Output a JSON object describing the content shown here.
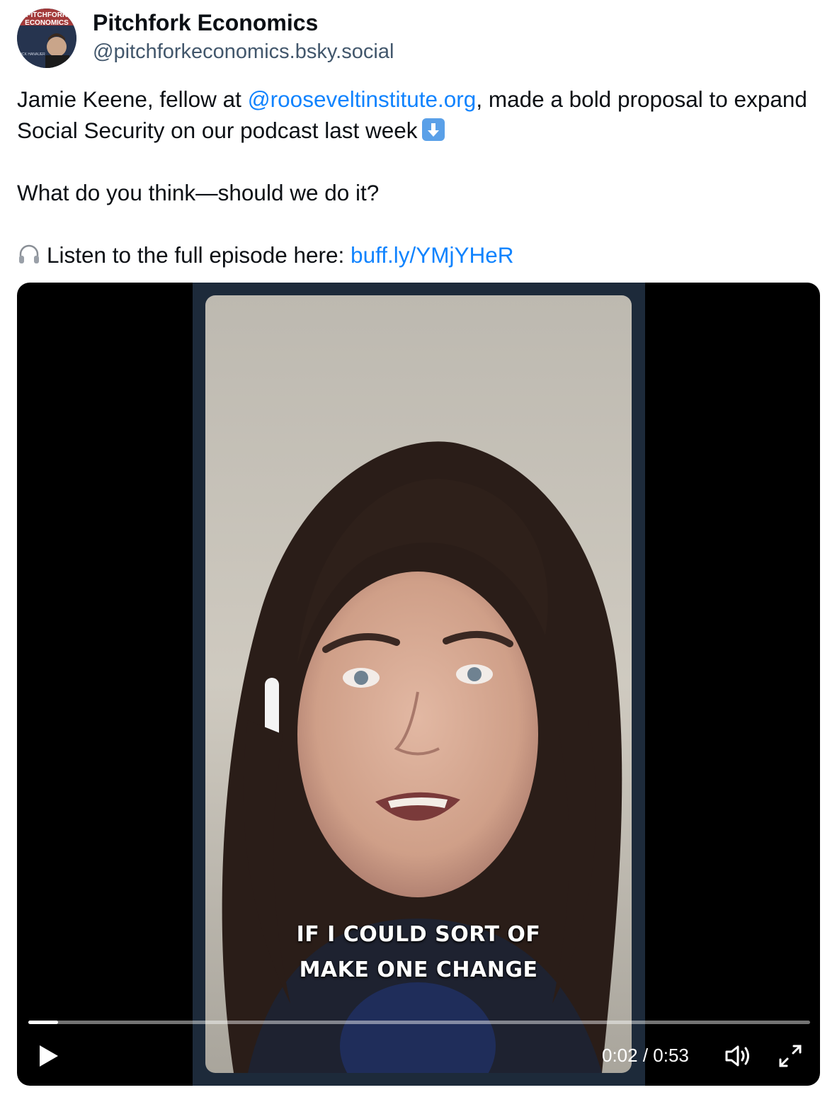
{
  "author": {
    "display_name": "Pitchfork Economics",
    "handle": "@pitchforkeconomics.bsky.social",
    "avatar_text": {
      "line1": "PITCHFORK",
      "line2": "ECONOMICS",
      "line3": "NICK HANAUER"
    }
  },
  "post": {
    "text_before_mention": "Jamie Keene, fellow at ",
    "mention": "@rooseveltinstitute.org",
    "text_after_mention": ", made a bold proposal to expand Social Security on our podcast last week",
    "down_arrow_emoji": "down-arrow-emoji",
    "paragraph2": "What do you think—should we do it?",
    "headphones_emoji": "headphones-emoji",
    "listen_text": "Listen to the full episode here: ",
    "link": "buff.ly/YMjYHeR"
  },
  "video": {
    "caption_line1": "IF I COULD SORT OF",
    "caption_line2": "MAKE ONE CHANGE",
    "current_time": "0:02",
    "duration": "0:53",
    "time_display": "0:02 / 0:53",
    "progress_fraction": 0.038,
    "play_icon": "play-icon",
    "volume_icon": "volume-icon",
    "fullscreen_icon": "fullscreen-icon"
  },
  "colors": {
    "link": "#1083fe",
    "handle": "#42576c",
    "frame": "#1d2a3a"
  }
}
